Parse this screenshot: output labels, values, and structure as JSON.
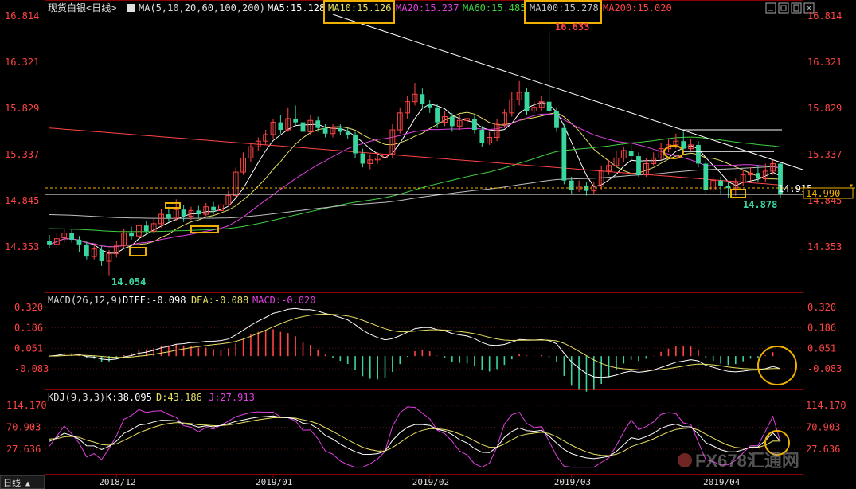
{
  "window": {
    "title": "现货白银<日线>",
    "toolbar_icons": [
      "minimize-icon",
      "expand-icon",
      "restore-icon",
      "close-icon"
    ],
    "bottom_tab": "日线",
    "watermark": "FX678汇通网"
  },
  "colors": {
    "background": "#000000",
    "up": "#ff4444",
    "down": "#3ad6a0",
    "ma5": "#ffffff",
    "ma10": "#e8e060",
    "ma20": "#e040e0",
    "ma60": "#40d040",
    "ma100": "#c0c0c0",
    "ma200": "#ff4444",
    "diff": "#ffffff",
    "dea": "#e8e060",
    "kdj_k": "#ffffff",
    "kdj_d": "#e8e060",
    "kdj_j": "#e040e0",
    "highlight": "#f0b000"
  },
  "price_panel": {
    "legend": {
      "ma_def": "MA(5,10,20,60,100,200)",
      "ma5": "MA5:15.128",
      "ma10": "MA10:15.126",
      "ma20": "MA20:15.237",
      "ma60": "MA60:15.485",
      "ma100": "MA100:15.278",
      "ma200": "MA200:15.020"
    },
    "y_ticks": [
      "16.814",
      "16.321",
      "15.829",
      "15.337",
      "14.845",
      "14.353"
    ],
    "annotations": {
      "high": "16.633",
      "low": "14.054",
      "recent_low": "14.878",
      "last": "14.915",
      "dash_price": "14.990"
    }
  },
  "macd_panel": {
    "legend": {
      "def": "MACD(26,12,9)",
      "diff": "DIFF:-0.098",
      "dea": "DEA:-0.088",
      "macd": "MACD:-0.020"
    },
    "y_ticks": [
      "0.320",
      "0.186",
      "0.051",
      "-0.083"
    ]
  },
  "kdj_panel": {
    "legend": {
      "def": "KDJ(9,3,3)",
      "k": "K:38.095",
      "d": "D:43.186",
      "j": "J:27.913"
    },
    "y_ticks": [
      "114.170",
      "70.903",
      "27.636"
    ]
  },
  "x_axis": {
    "labels": [
      "2018/12",
      "2019/01",
      "2019/02",
      "2019/03",
      "2019/04"
    ]
  },
  "chart_data": {
    "type": "candlestick",
    "ylim": [
      14.0,
      16.9
    ],
    "macd_ylim": [
      -0.22,
      0.34
    ],
    "kdj_ylim": [
      -10,
      130
    ],
    "x_label_index": [
      9,
      30,
      51,
      70,
      90
    ],
    "candles": [
      [
        14.42,
        14.38,
        14.48,
        14.34
      ],
      [
        14.38,
        14.44,
        14.5,
        14.33
      ],
      [
        14.45,
        14.5,
        14.55,
        14.4
      ],
      [
        14.5,
        14.43,
        14.54,
        14.4
      ],
      [
        14.43,
        14.38,
        14.47,
        14.3
      ],
      [
        14.38,
        14.25,
        14.41,
        14.22
      ],
      [
        14.25,
        14.33,
        14.38,
        14.22
      ],
      [
        14.32,
        14.2,
        14.36,
        14.15
      ],
      [
        14.2,
        14.28,
        14.32,
        14.05
      ],
      [
        14.28,
        14.37,
        14.42,
        14.24
      ],
      [
        14.37,
        14.5,
        14.55,
        14.34
      ],
      [
        14.5,
        14.47,
        14.57,
        14.43
      ],
      [
        14.47,
        14.58,
        14.62,
        14.44
      ],
      [
        14.58,
        14.52,
        14.63,
        14.48
      ],
      [
        14.52,
        14.6,
        14.66,
        14.49
      ],
      [
        14.6,
        14.7,
        14.76,
        14.56
      ],
      [
        14.7,
        14.66,
        14.78,
        14.62
      ],
      [
        14.66,
        14.75,
        14.86,
        14.63
      ],
      [
        14.75,
        14.68,
        14.8,
        14.62
      ],
      [
        14.68,
        14.74,
        14.78,
        14.64
      ],
      [
        14.74,
        14.7,
        14.79,
        14.66
      ],
      [
        14.7,
        14.78,
        14.82,
        14.68
      ],
      [
        14.78,
        14.74,
        14.83,
        14.7
      ],
      [
        14.74,
        14.8,
        14.84,
        14.72
      ],
      [
        14.8,
        14.9,
        14.95,
        14.78
      ],
      [
        14.9,
        15.15,
        15.2,
        14.88
      ],
      [
        15.15,
        15.3,
        15.36,
        15.12
      ],
      [
        15.3,
        15.42,
        15.46,
        15.26
      ],
      [
        15.42,
        15.48,
        15.52,
        15.38
      ],
      [
        15.48,
        15.55,
        15.6,
        15.44
      ],
      [
        15.55,
        15.68,
        15.72,
        15.5
      ],
      [
        15.68,
        15.6,
        15.76,
        15.56
      ],
      [
        15.6,
        15.72,
        15.84,
        15.58
      ],
      [
        15.72,
        15.68,
        15.86,
        15.64
      ],
      [
        15.68,
        15.58,
        15.74,
        15.52
      ],
      [
        15.58,
        15.7,
        15.76,
        15.54
      ],
      [
        15.7,
        15.62,
        15.74,
        15.58
      ],
      [
        15.62,
        15.56,
        15.66,
        15.52
      ],
      [
        15.56,
        15.62,
        15.66,
        15.52
      ],
      [
        15.62,
        15.58,
        15.66,
        15.54
      ],
      [
        15.58,
        15.55,
        15.62,
        15.5
      ],
      [
        15.55,
        15.35,
        15.58,
        15.3
      ],
      [
        15.35,
        15.24,
        15.4,
        15.2
      ],
      [
        15.24,
        15.28,
        15.34,
        15.18
      ],
      [
        15.28,
        15.3,
        15.36,
        15.24
      ],
      [
        15.3,
        15.34,
        15.4,
        15.26
      ],
      [
        15.34,
        15.6,
        15.66,
        15.3
      ],
      [
        15.6,
        15.78,
        15.84,
        15.56
      ],
      [
        15.78,
        15.9,
        15.96,
        15.72
      ],
      [
        15.9,
        15.98,
        16.1,
        15.86
      ],
      [
        15.98,
        15.88,
        16.04,
        15.82
      ],
      [
        15.88,
        15.84,
        15.92,
        15.78
      ],
      [
        15.84,
        15.68,
        15.88,
        15.62
      ],
      [
        15.68,
        15.74,
        15.8,
        15.64
      ],
      [
        15.74,
        15.64,
        15.78,
        15.58
      ],
      [
        15.64,
        15.7,
        15.76,
        15.6
      ],
      [
        15.7,
        15.72,
        15.76,
        15.64
      ],
      [
        15.72,
        15.6,
        15.76,
        15.56
      ],
      [
        15.6,
        15.46,
        15.64,
        15.42
      ],
      [
        15.46,
        15.52,
        15.58,
        15.44
      ],
      [
        15.52,
        15.66,
        15.72,
        15.48
      ],
      [
        15.66,
        15.78,
        15.82,
        15.62
      ],
      [
        15.78,
        15.92,
        16.0,
        15.74
      ],
      [
        15.92,
        16.0,
        16.12,
        15.86
      ],
      [
        16.0,
        15.8,
        16.04,
        15.76
      ],
      [
        15.8,
        15.84,
        15.9,
        15.78
      ],
      [
        15.84,
        15.9,
        15.96,
        15.8
      ],
      [
        15.9,
        15.8,
        16.63,
        15.76
      ],
      [
        15.8,
        15.62,
        15.84,
        15.58
      ],
      [
        15.62,
        15.06,
        15.66,
        15.02
      ],
      [
        15.06,
        14.96,
        15.1,
        14.92
      ],
      [
        14.96,
        15.0,
        15.06,
        14.94
      ],
      [
        15.0,
        14.95,
        15.04,
        14.9
      ],
      [
        14.95,
        15.0,
        15.05,
        14.92
      ],
      [
        15.0,
        15.16,
        15.22,
        14.96
      ],
      [
        15.16,
        15.22,
        15.28,
        15.12
      ],
      [
        15.22,
        15.3,
        15.38,
        15.2
      ],
      [
        15.3,
        15.38,
        15.42,
        15.26
      ],
      [
        15.38,
        15.32,
        15.44,
        15.28
      ],
      [
        15.32,
        15.12,
        15.36,
        15.1
      ],
      [
        15.12,
        15.24,
        15.3,
        15.1
      ],
      [
        15.24,
        15.3,
        15.36,
        15.22
      ],
      [
        15.3,
        15.4,
        15.46,
        15.28
      ],
      [
        15.4,
        15.44,
        15.5,
        15.36
      ],
      [
        15.44,
        15.48,
        15.56,
        15.4
      ],
      [
        15.48,
        15.4,
        15.58,
        15.36
      ],
      [
        15.4,
        15.44,
        15.5,
        15.38
      ],
      [
        15.44,
        15.24,
        15.48,
        15.2
      ],
      [
        15.24,
        14.96,
        15.28,
        14.92
      ],
      [
        14.96,
        15.06,
        15.1,
        14.94
      ],
      [
        15.06,
        15.0,
        15.1,
        14.92
      ],
      [
        15.0,
        14.98,
        15.04,
        14.88
      ],
      [
        14.98,
        15.04,
        15.08,
        14.9
      ],
      [
        15.04,
        15.12,
        15.18,
        15.0
      ],
      [
        15.12,
        15.14,
        15.2,
        15.06
      ],
      [
        15.14,
        15.08,
        15.22,
        15.04
      ],
      [
        15.08,
        15.16,
        15.24,
        15.04
      ],
      [
        15.16,
        15.24,
        15.28,
        15.12
      ],
      [
        15.24,
        14.92,
        15.26,
        14.88
      ]
    ]
  }
}
